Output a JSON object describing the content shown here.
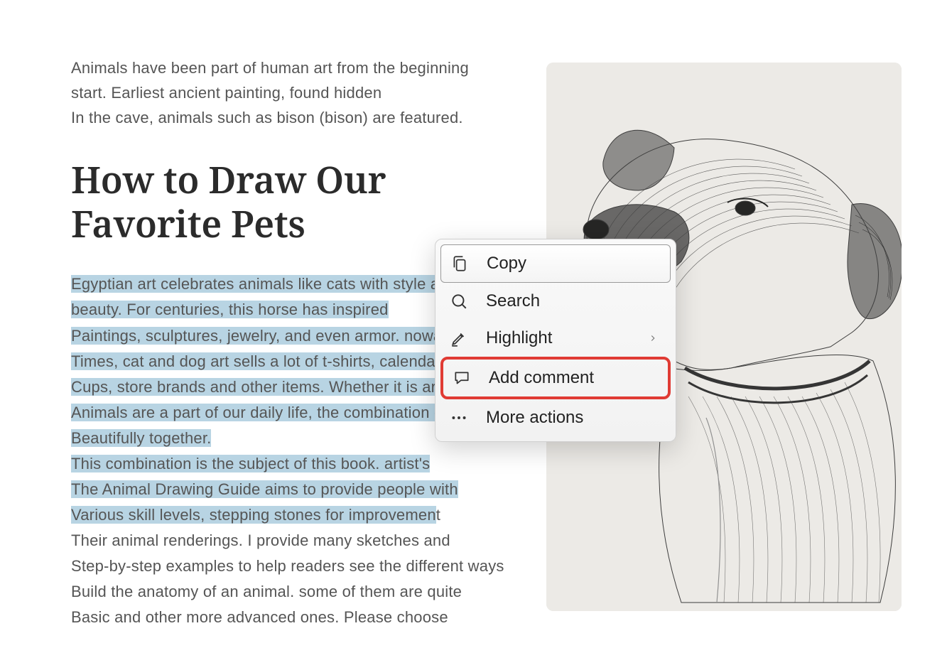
{
  "intro": [
    "Animals have been part of human art from the beginning",
    "start. Earliest ancient painting, found hidden",
    "In the cave, animals such as bison (bison) are featured."
  ],
  "heading": "How to Draw Our Favorite Pets",
  "body_highlighted": [
    "Egyptian art celebrates animals like cats with style and style",
    "beauty. For centuries, this horse has inspired",
    "Paintings, sculptures, jewelry, and even armor. nowadays",
    "Times, cat and dog art sells a lot of t-shirts, calendars, coffe",
    "Cups, store brands and other items. Whether it is art or dom",
    "Animals are a part of our daily life, the combination of the tw",
    "Beautifully together.",
    "This combination is the subject of this book. artist's",
    "The Animal Drawing Guide aims to provide people with",
    "Various skill levels, stepping stones for improvemen"
  ],
  "body_partial_t": "t",
  "body_rest": [
    "Their animal renderings. I provide many sketches and",
    "Step-by-step examples to help readers see the different ways",
    "Build the anatomy of an animal. some of them are quite",
    "Basic and other more advanced ones. Please choose"
  ],
  "menu": {
    "copy": "Copy",
    "search": "Search",
    "highlight": "Highlight",
    "add_comment": "Add comment",
    "more_actions": "More actions"
  },
  "image_alt": "pencil sketch of a dog with collar, looking left"
}
